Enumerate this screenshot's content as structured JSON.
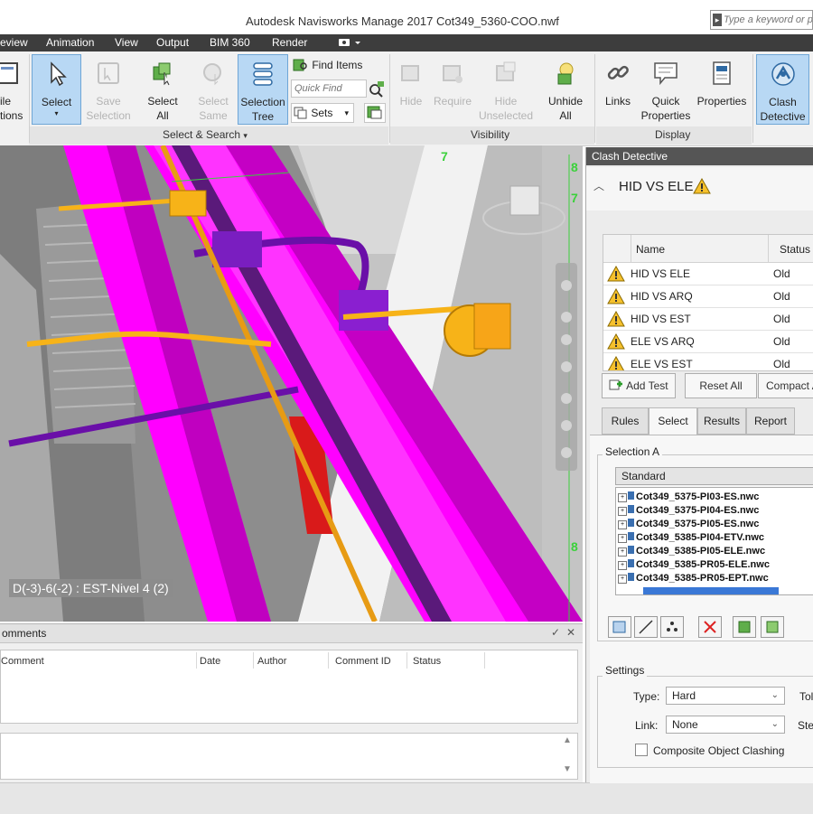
{
  "window": {
    "title": "Autodesk Navisworks Manage 2017    Cot349_5360-COO.nwf",
    "search_placeholder": "Type a keyword or p"
  },
  "menu": [
    "eview",
    "Animation",
    "View",
    "Output",
    "BIM 360",
    "Render"
  ],
  "ribbon": {
    "compile": {
      "line1": "ile",
      "line2": "tions"
    },
    "select": {
      "label": "Select"
    },
    "save_selection": {
      "line1": "Save",
      "line2": "Selection"
    },
    "select_all": {
      "line1": "Select",
      "line2": "All"
    },
    "select_same": {
      "line1": "Select",
      "line2": "Same"
    },
    "selection_tree": {
      "line1": "Selection",
      "line2": "Tree"
    },
    "find_items": "Find Items",
    "quick_find_placeholder": "Quick Find",
    "sets": "Sets",
    "hide": "Hide",
    "require": "Require",
    "hide_unselected": {
      "line1": "Hide",
      "line2": "Unselected"
    },
    "unhide_all": {
      "line1": "Unhide",
      "line2": "All"
    },
    "links": "Links",
    "quick_properties": {
      "line1": "Quick",
      "line2": "Properties"
    },
    "properties": "Properties",
    "clash_detective": {
      "line1": "Clash",
      "line2": "Detective"
    },
    "groups": {
      "select_search": "Select & Search",
      "visibility": "Visibility",
      "display": "Display"
    }
  },
  "viewport": {
    "label": "D(-3)-6(-2) : EST-Nivel 4 (2)",
    "grid_numbers": [
      "7",
      "8",
      "7",
      "8"
    ]
  },
  "comments": {
    "title": "omments",
    "columns": [
      "Comment",
      "Date",
      "Author",
      "Comment ID",
      "Status"
    ]
  },
  "clash": {
    "panel_title": "Clash Detective",
    "current_test": "HID VS ELE",
    "table_headers": {
      "name": "Name",
      "status": "Status"
    },
    "tests": [
      {
        "name": "HID VS ELE",
        "status": "Old"
      },
      {
        "name": "HID VS ARQ",
        "status": "Old"
      },
      {
        "name": "HID VS EST",
        "status": "Old"
      },
      {
        "name": "ELE VS ARQ",
        "status": "Old"
      },
      {
        "name": "ELE VS EST",
        "status": "Old"
      }
    ],
    "buttons": {
      "add_test": "Add Test",
      "reset_all": "Reset All",
      "compact": "Compact A"
    },
    "tabs": [
      "Rules",
      "Select",
      "Results",
      "Report"
    ],
    "selection_a": {
      "label": "Selection A",
      "mode": "Standard",
      "files": [
        "Cot349_5375-PI03-ES.nwc",
        "Cot349_5375-PI04-ES.nwc",
        "Cot349_5375-PI05-ES.nwc",
        "Cot349_5385-PI04-ETV.nwc",
        "Cot349_5385-PI05-ELE.nwc",
        "Cot349_5385-PR05-ELE.nwc",
        "Cot349_5385-PR05-EPT.nwc"
      ]
    },
    "settings": {
      "label": "Settings",
      "type_label": "Type:",
      "type_value": "Hard",
      "link_label": "Link:",
      "link_value": "None",
      "tolerance_label": "Tol",
      "step_label": "Ste",
      "composite_label": "Composite Object Clashing"
    }
  }
}
